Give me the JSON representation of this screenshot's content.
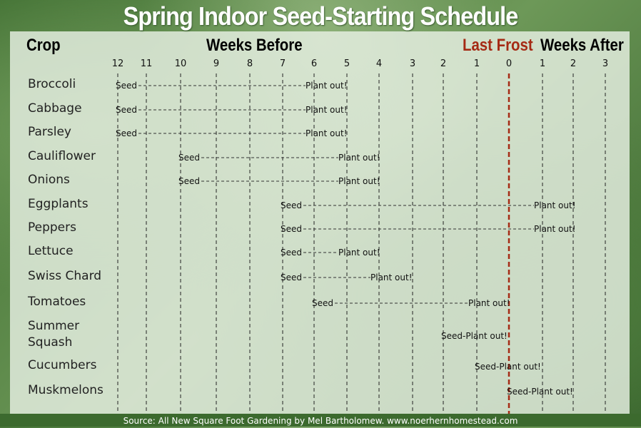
{
  "title": "Spring Indoor Seed-Starting Schedule",
  "headers": {
    "crop": "Crop",
    "weeks_before": "Weeks Before",
    "last_frost": "Last Frost",
    "weeks_after": "Weeks After"
  },
  "colors": {
    "last_frost": "#a52a14",
    "text": "#111111"
  },
  "footer": "Source: All New Square Foot Gardening by Mel Bartholomew. www.noerhernhomestead.com",
  "chart_data": {
    "type": "gantt",
    "x_ticks": [
      "12",
      "11",
      "10",
      "9",
      "8",
      "7",
      "6",
      "5",
      "4",
      "3",
      "2",
      "1",
      "0",
      "1",
      "2",
      "3"
    ],
    "x_units": "weeks relative to last frost (negative = before)",
    "marker_labels": {
      "seed": "Seed",
      "plant": "Plant out!",
      "combined": "Seed-Plant out!"
    },
    "rows": [
      {
        "crop": "Broccoli",
        "seed": -12,
        "plant": -6
      },
      {
        "crop": "Cabbage",
        "seed": -12,
        "plant": -6
      },
      {
        "crop": "Parsley",
        "seed": -12,
        "plant": -6
      },
      {
        "crop": "Cauliflower",
        "seed": -10,
        "plant": -5
      },
      {
        "crop": "Onions",
        "seed": -10,
        "plant": -5
      },
      {
        "crop": "Eggplants",
        "seed": -7,
        "plant": 1
      },
      {
        "crop": "Peppers",
        "seed": -7,
        "plant": 1
      },
      {
        "crop": "Lettuce",
        "seed": -7,
        "plant": -5
      },
      {
        "crop": "Swiss Chard",
        "seed": -7,
        "plant": -4
      },
      {
        "crop": "Tomatoes",
        "seed": -6,
        "plant": -1
      },
      {
        "crop": "Summer Squash",
        "seed": -2,
        "plant": -2
      },
      {
        "crop": "Cucumbers",
        "seed": -1,
        "plant": -1
      },
      {
        "crop": "Muskmelons",
        "seed": 0,
        "plant": 0
      }
    ]
  }
}
